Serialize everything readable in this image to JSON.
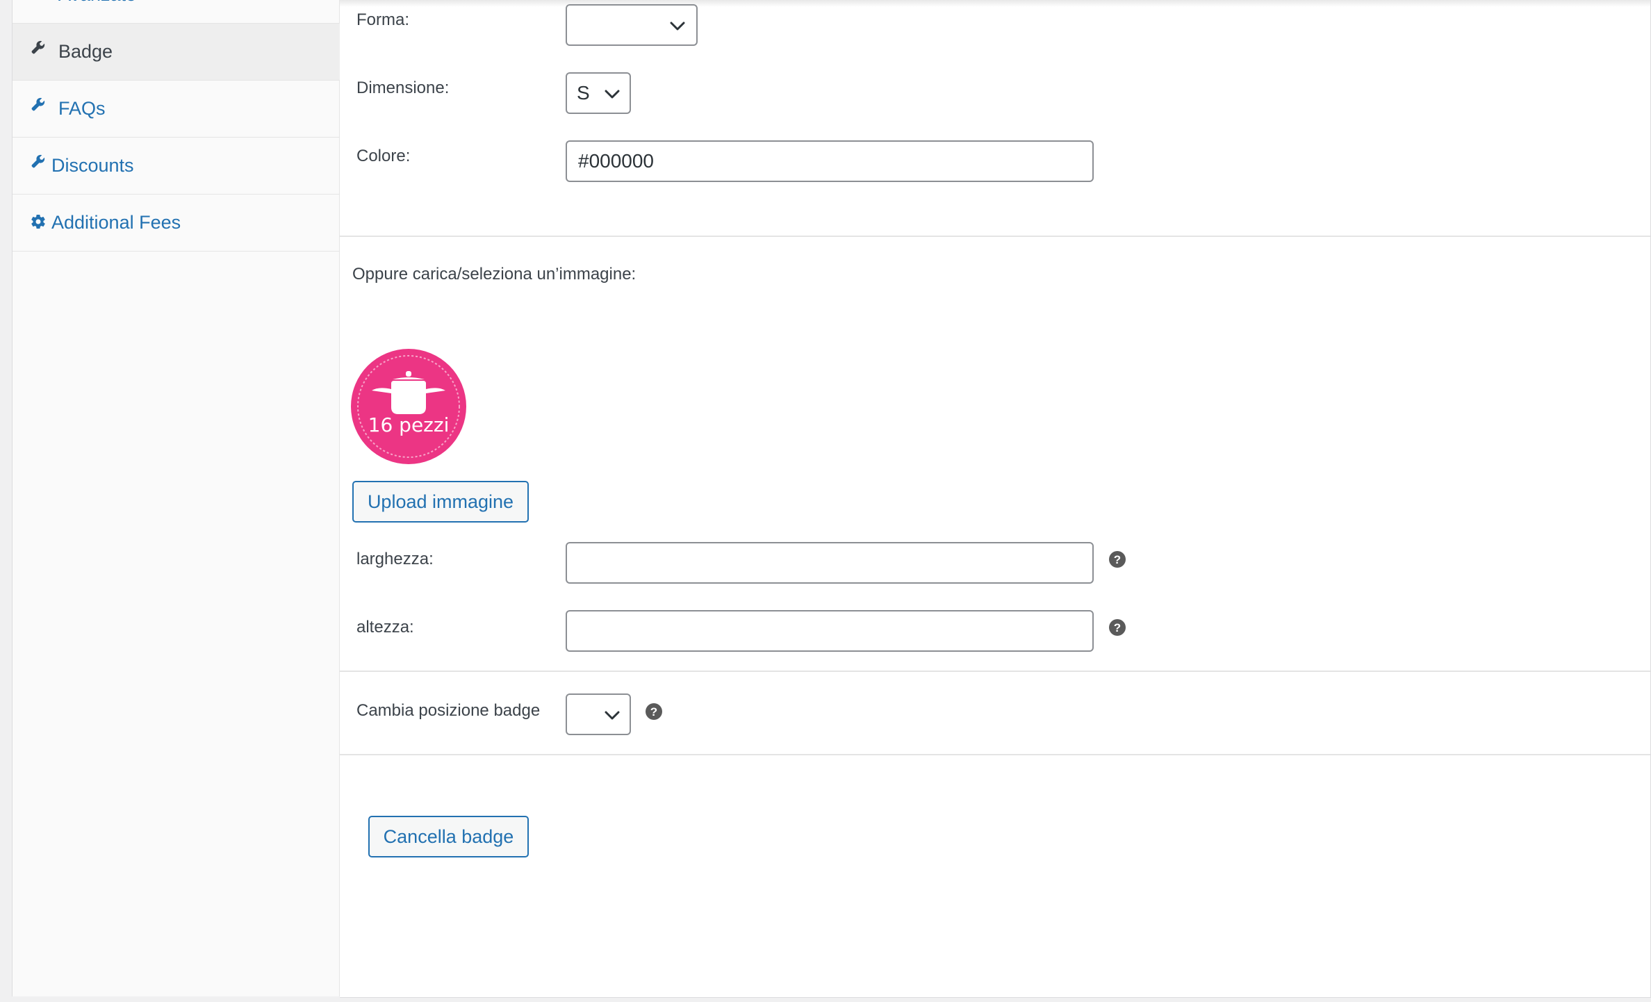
{
  "sidebar": {
    "items": [
      {
        "label": "Avanzato",
        "icon": "wrench-icon"
      },
      {
        "label": "Badge",
        "icon": "wrench-icon",
        "active": true
      },
      {
        "label": "FAQs",
        "icon": "wrench-icon"
      },
      {
        "label": "Discounts",
        "icon": "wrench-icon"
      },
      {
        "label": "Additional Fees",
        "icon": "gear-icon"
      }
    ]
  },
  "form": {
    "shape_label": "Forma:",
    "shape_value": "",
    "size_label": "Dimensione:",
    "size_value": "S",
    "color_label": "Colore:",
    "color_value": "#000000",
    "image_section_label": "Oppure carica/seleziona un’immagine:",
    "badge_image_text": "16 pezzi",
    "upload_button": "Upload immagine",
    "width_label": "larghezza:",
    "width_value": "",
    "height_label": "altezza:",
    "height_value": "",
    "position_label": "Cambia posizione badge",
    "position_value": "",
    "help_glyph": "?",
    "delete_button": "Cancella badge"
  },
  "colors": {
    "link": "#2271b1",
    "badge_pink": "#ec3584",
    "help_icon": "#5a5a5a"
  }
}
